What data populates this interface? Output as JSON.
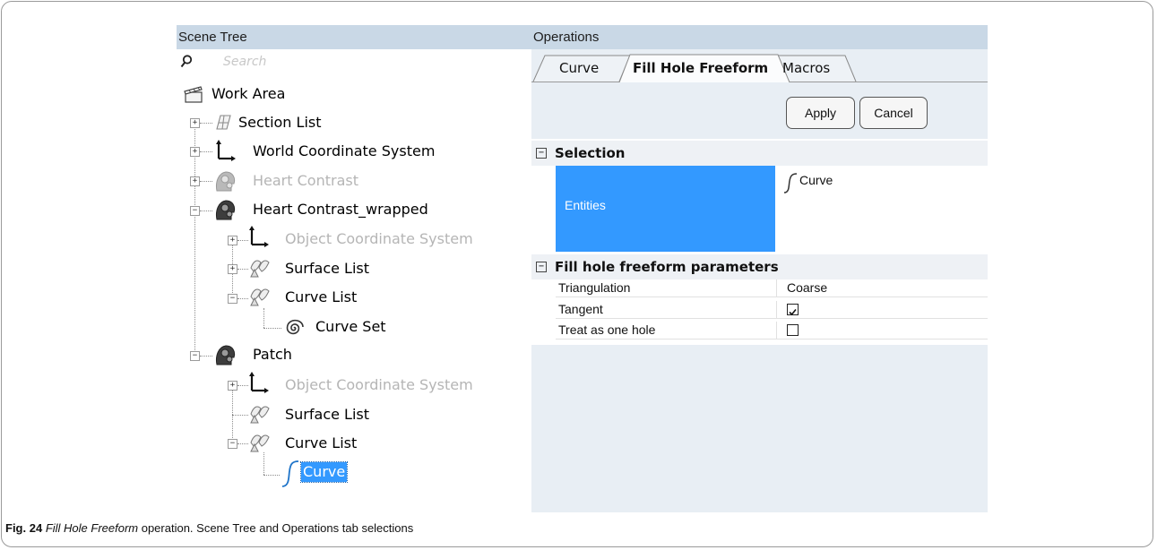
{
  "scene_tree": {
    "title": "Scene Tree",
    "search_placeholder": "Search",
    "items": [
      {
        "label": "Work Area"
      },
      {
        "label": "Section List"
      },
      {
        "label": "World Coordinate System"
      },
      {
        "label": "Heart Contrast"
      },
      {
        "label": "Heart Contrast_wrapped"
      },
      {
        "label": "Object Coordinate System"
      },
      {
        "label": "Surface List"
      },
      {
        "label": "Curve List"
      },
      {
        "label": "Curve Set"
      },
      {
        "label": "Patch"
      },
      {
        "label": "Object Coordinate System"
      },
      {
        "label": "Surface List"
      },
      {
        "label": "Curve List"
      },
      {
        "label": "Curve"
      }
    ]
  },
  "operations": {
    "title": "Operations",
    "tabs": [
      {
        "label": "Curve"
      },
      {
        "label": "Fill Hole Freeform"
      },
      {
        "label": "Macros"
      }
    ],
    "apply_label": "Apply",
    "cancel_label": "Cancel",
    "selection": {
      "heading": "Selection",
      "entities_label": "Entities",
      "entities_value": "Curve"
    },
    "params": {
      "heading": "Fill hole freeform parameters",
      "rows": [
        {
          "name": "Triangulation",
          "value": "Coarse"
        },
        {
          "name": "Tangent",
          "checked": true
        },
        {
          "name": "Treat as one hole",
          "checked": false
        }
      ]
    }
  },
  "caption": {
    "fig": "Fig. 24",
    "title": "Fill Hole Freeform",
    "rest": " operation. Scene Tree and Operations tab selections"
  },
  "colors": {
    "header_bg": "#c9d8e6",
    "selection_blue": "#3399ff",
    "dim_text": "#b5b5b5"
  }
}
